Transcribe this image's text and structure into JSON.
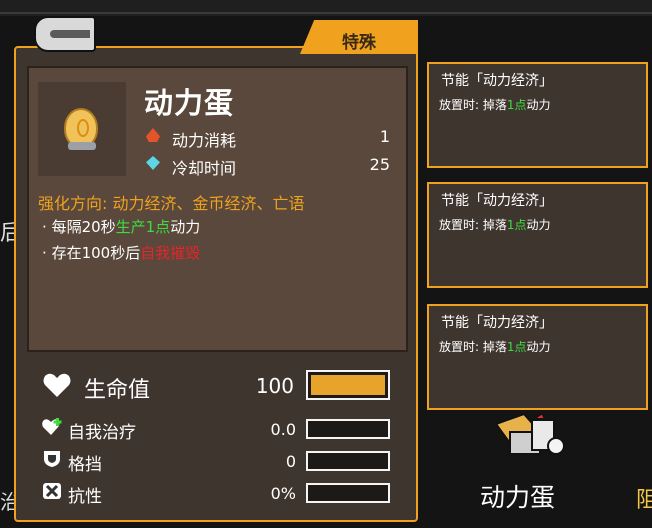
{
  "card": {
    "tag": "特殊",
    "title": "动力蛋",
    "stats": [
      {
        "icon": "fire-icon",
        "label": "动力消耗",
        "value": "1"
      },
      {
        "icon": "gem-icon",
        "label": "冷却时间",
        "value": "25"
      }
    ],
    "upgrade_direction": "强化方向: 动力经济、金币经济、亡语",
    "effects": [
      {
        "bullet": "·",
        "pre": "每隔20秒",
        "highlight": "生产1点",
        "post": "动力",
        "color": "green"
      },
      {
        "bullet": "·",
        "pre": "存在100秒后",
        "highlight": "自我摧毁",
        "post": "",
        "color": "red"
      }
    ]
  },
  "attributes": {
    "hp": {
      "label": "生命值",
      "value": "100",
      "fill_percent": 100
    },
    "sub": [
      {
        "icon": "heal-icon",
        "label": "自我治疗",
        "value": "0.0",
        "fill_percent": 0
      },
      {
        "icon": "shield-icon",
        "label": "格挡",
        "value": "0",
        "fill_percent": 0
      },
      {
        "icon": "resist-icon",
        "label": "抗性",
        "value": "0%",
        "fill_percent": 0
      }
    ]
  },
  "side_cards": [
    {
      "title": "节能「动力经济」",
      "desc_pre": "放置时: 掉落",
      "desc_hl": "1点",
      "desc_post": "动力"
    },
    {
      "title": "节能「动力经济」",
      "desc_pre": "放置时: 掉落",
      "desc_hl": "1点",
      "desc_post": "动力"
    },
    {
      "title": "节能「动力经济」",
      "desc_pre": "放置时: 掉落",
      "desc_hl": "1点",
      "desc_post": "动力"
    }
  ],
  "selected_item": {
    "label": "动力蛋"
  },
  "edge_text": {
    "left_top": "后",
    "left_bottom": "治",
    "right_bottom": "阻"
  },
  "colors": {
    "accent": "#f0a21e",
    "green": "#3fdc3f",
    "red": "#e3262b"
  }
}
